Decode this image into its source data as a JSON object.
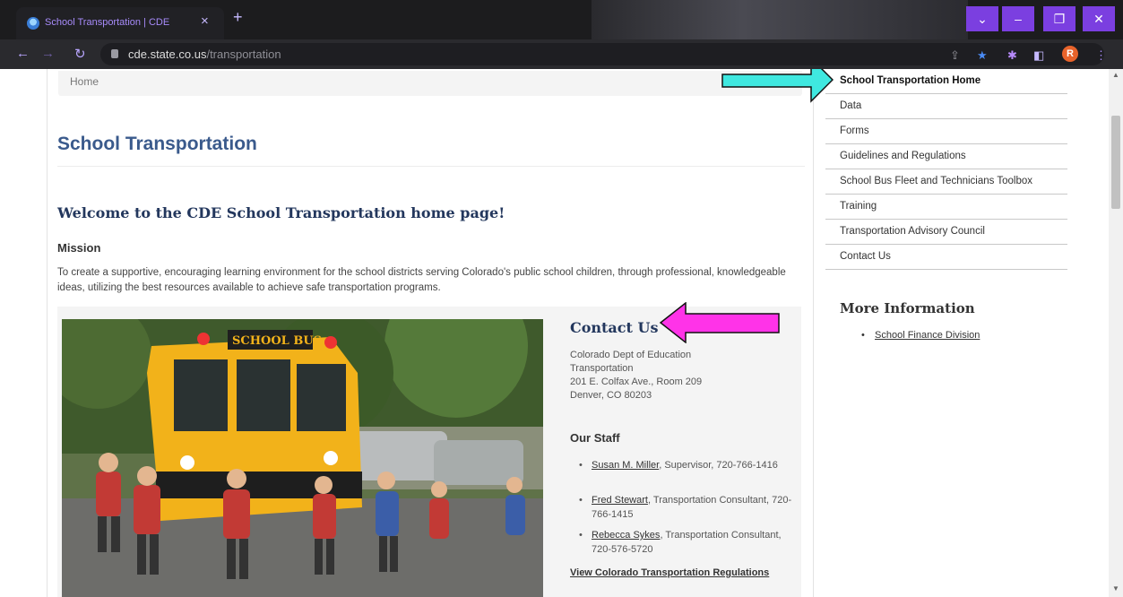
{
  "browser": {
    "tab_title": "School Transportation | CDE",
    "tab_close": "×",
    "new_tab": "+",
    "url_host": "cde.state.co.us",
    "url_path": "/transportation",
    "profile_initial": "R",
    "icons": [
      "favicon-icon",
      "close-icon",
      "plus-icon",
      "back-icon",
      "forward-icon",
      "reload-icon",
      "lock-icon",
      "share-icon",
      "star-icon",
      "extensions-icon",
      "sidepanel-icon",
      "avatar",
      "menu-icon",
      "chevron-down-icon",
      "minimize-icon",
      "restore-icon",
      "window-close-icon"
    ],
    "accent_color": "#7b3fe0"
  },
  "breadcrumb": {
    "home": "Home"
  },
  "page": {
    "title": "School Transportation",
    "welcome": "Welcome to the CDE School Transportation home page!",
    "mission_heading": "Mission",
    "mission_text": "To create a supportive, encouraging learning environment for the school districts serving Colorado's public school children, through professional, knowledgeable ideas, utilizing the best resources available to achieve safe transportation programs."
  },
  "contact": {
    "heading": "Contact Us",
    "address": [
      "Colorado Dept of Education",
      "Transportation",
      "201 E. Colfax Ave., Room 209",
      "Denver, CO 80203"
    ],
    "staff_heading": "Our Staff",
    "staff": [
      {
        "name": "Susan M. Miller",
        "detail": ", Supervisor, 720-766-1416"
      },
      {
        "name": "Fred Stewart",
        "detail": ", Transportation Consultant, 720-766-1415"
      },
      {
        "name": "Rebecca Sykes",
        "detail": ", Transportation Consultant, 720-576-5720"
      }
    ],
    "regs_link": "View Colorado Transportation Regulations"
  },
  "sidebar": {
    "items": [
      {
        "label": "School Transportation Home",
        "active": true
      },
      {
        "label": "Data"
      },
      {
        "label": "Forms"
      },
      {
        "label": "Guidelines and Regulations"
      },
      {
        "label": "School Bus Fleet and Technicians Toolbox"
      },
      {
        "label": "Training"
      },
      {
        "label": "Transportation Advisory Council"
      },
      {
        "label": "Contact Us"
      }
    ],
    "more_info_heading": "More Information",
    "more_info_link": "School Finance Division"
  },
  "photo": {
    "bus_sign": "SCHOOL BUS"
  },
  "annotations": {
    "cyan_arrow_color": "#3fe8e0",
    "magenta_arrow_color": "#ff33e8"
  }
}
